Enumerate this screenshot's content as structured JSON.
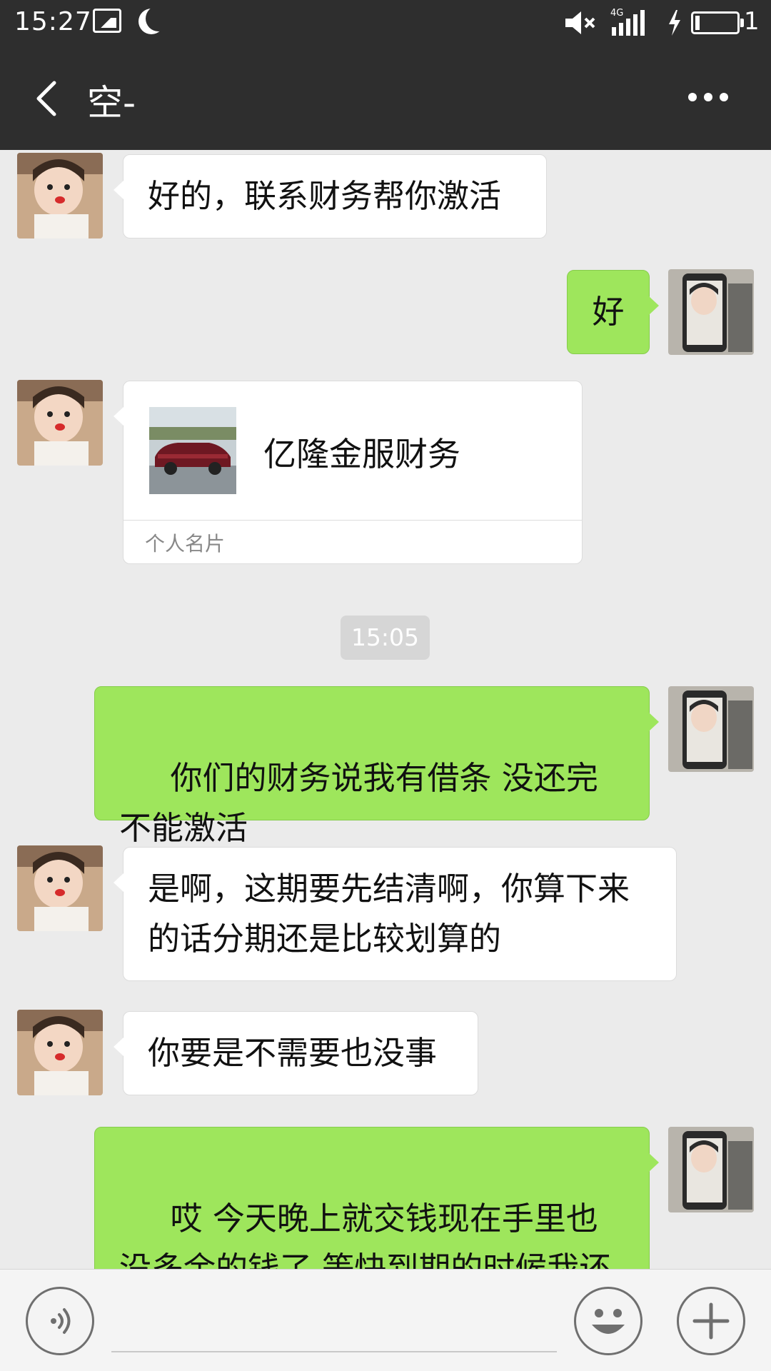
{
  "status_bar": {
    "time": "15:27",
    "network": "4G",
    "battery_text": "1"
  },
  "header": {
    "title": "空-"
  },
  "messages": [
    {
      "sender": "other",
      "text": "好的，联系财务帮你激活"
    },
    {
      "sender": "me",
      "text": "好"
    },
    {
      "sender": "other",
      "type": "contact-card",
      "name": "亿隆金服财务",
      "card_type": "个人名片"
    },
    {
      "timestamp": "15:05"
    },
    {
      "sender": "me",
      "text": " 你们的财务说我有借条 没还完 不能激活"
    },
    {
      "sender": "other",
      "text": "是啊，这期要先结清啊，你算下来的话分期还是比较划算的"
    },
    {
      "sender": "other",
      "text": "你要是不需要也没事"
    },
    {
      "sender": "me",
      "text": " 哎 今天晚上就交钱现在手里也没多余的钱了 等快到期的时候我还上再说吧"
    }
  ],
  "colors": {
    "bar": "#2e2e2e",
    "background": "#ebebeb",
    "my_bubble": "#9ee65c",
    "other_bubble": "#ffffff"
  },
  "icons": {
    "back": "chevron-left-icon",
    "more": "more-horizontal-icon",
    "voice": "voice-icon",
    "emoji": "emoji-icon",
    "plus": "plus-icon"
  }
}
